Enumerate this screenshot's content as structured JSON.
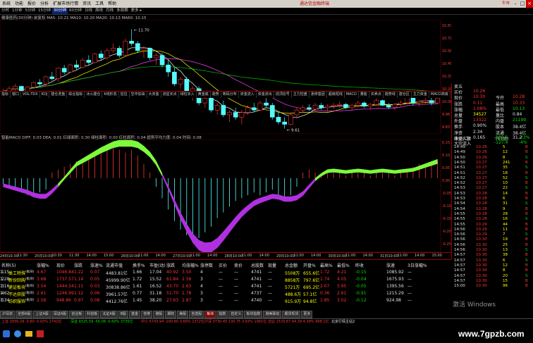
{
  "menu": {
    "items": [
      "系统",
      "功能",
      "报价",
      "分析",
      "扩展市场行情",
      "资讯",
      "工具",
      "帮助"
    ],
    "title": "通达信金融终端",
    "badge": "牛市"
  },
  "periods": [
    "分时",
    "1分钟",
    "5分钟",
    "15分钟",
    "30分钟",
    "60分钟",
    "日线",
    "周线",
    "月线",
    "多周期",
    "更多 ▸"
  ],
  "periods_active": 4,
  "chart": {
    "info": "健康医药(30分钟) 前复权  MA5: 10.21  MA10: 10.20  MA20: 10.13  MA60: 10.15",
    "high_label": "11.70",
    "low_label": "9.61",
    "price_scale": [
      "10.83",
      "10.71",
      "10.58",
      "10.45",
      "10.33",
      "10.20",
      "10.08",
      "9.96",
      "9.83"
    ],
    "macd_info": "智能MACD  DIFF: 0.03  DEA: 0.01  红绿面积: 0.30  绿柱面积: 0.00  红柱面积: 0.04  趋势平均力度: 0.04  时间: 0.08",
    "macd_scale": [
      "0.15",
      "0.10",
      "0.05",
      "0.00",
      "-0.05",
      "-0.10",
      "-0.15",
      "-0.20",
      "-0.25"
    ],
    "indicator_tabs": [
      "指标",
      "窗口",
      "VOL-TDX",
      "KDJ",
      "建仓洗盘",
      "综合指标",
      "冰火建仓",
      "K线形态",
      "狂拉",
      "空中加油",
      "大资金",
      "流星买点",
      "绿柱买入",
      "黄金底",
      "趋势",
      "筹码分布",
      "资金流入",
      "资金流出",
      "逃顶信号",
      "主力控盘",
      "涨停基因",
      "超级短线",
      "MACD",
      "量能",
      "买卖点",
      "趋势线",
      "建仓区",
      "主力资金",
      "MACD高级",
      "智能MACD",
      "更多"
    ],
    "time_labels": [
      "24日10:30",
      "11:30",
      "25日10:00",
      "10:30",
      "11:30",
      "14:00",
      "15:00",
      "26日10:00",
      "11:00",
      "14:00",
      "27日10:00",
      "11:00",
      "14:00",
      "28日10:00",
      "11:00",
      "14:00",
      "29日10:00",
      "11:00",
      "14:00",
      "30日10:00",
      "11:00",
      "14:00",
      "31日10:00",
      "11:00",
      "14:00",
      "15:00"
    ]
  },
  "chart_data": {
    "type": "candlestick",
    "title": "",
    "ylim": [
      9.5,
      11.9
    ],
    "candles": [
      [
        10.3,
        10.45,
        10.25,
        10.4
      ],
      [
        10.4,
        10.5,
        10.35,
        10.45
      ],
      [
        10.45,
        10.55,
        10.4,
        10.5
      ],
      [
        10.5,
        10.5,
        10.35,
        10.38
      ],
      [
        10.38,
        10.5,
        10.3,
        10.48
      ],
      [
        10.48,
        10.6,
        10.45,
        10.58
      ],
      [
        10.58,
        10.65,
        10.5,
        10.55
      ],
      [
        10.55,
        10.72,
        10.5,
        10.7
      ],
      [
        10.7,
        10.8,
        10.62,
        10.66
      ],
      [
        10.66,
        10.9,
        10.6,
        10.88
      ],
      [
        10.88,
        10.95,
        10.75,
        10.8
      ],
      [
        10.8,
        10.98,
        10.78,
        10.95
      ],
      [
        10.95,
        11.05,
        10.85,
        10.9
      ],
      [
        10.9,
        11.1,
        10.88,
        11.05
      ],
      [
        11.05,
        11.15,
        10.95,
        11.0
      ],
      [
        11.0,
        11.2,
        10.98,
        11.18
      ],
      [
        11.18,
        11.25,
        11.05,
        11.1
      ],
      [
        11.1,
        11.3,
        11.05,
        11.25
      ],
      [
        11.25,
        11.4,
        11.2,
        11.3
      ],
      [
        11.3,
        11.35,
        11.1,
        11.15
      ],
      [
        11.15,
        11.5,
        11.12,
        11.45
      ],
      [
        11.45,
        11.7,
        11.35,
        11.4
      ],
      [
        11.4,
        11.45,
        11.2,
        11.25
      ],
      [
        11.25,
        11.35,
        11.1,
        11.3
      ],
      [
        11.3,
        11.32,
        11.05,
        11.1
      ],
      [
        11.1,
        11.2,
        10.95,
        11.15
      ],
      [
        11.15,
        11.2,
        10.9,
        10.95
      ],
      [
        10.95,
        11.05,
        10.7,
        10.8
      ],
      [
        10.8,
        10.9,
        10.5,
        10.55
      ],
      [
        10.55,
        10.7,
        10.45,
        10.65
      ],
      [
        10.65,
        10.7,
        10.3,
        10.35
      ],
      [
        10.35,
        10.5,
        10.2,
        10.45
      ],
      [
        10.45,
        10.5,
        10.1,
        10.15
      ],
      [
        10.15,
        10.3,
        10.05,
        10.25
      ],
      [
        10.25,
        10.3,
        9.95,
        10.0
      ],
      [
        10.0,
        10.15,
        9.9,
        10.1
      ],
      [
        10.1,
        10.2,
        9.85,
        9.9
      ],
      [
        9.9,
        10.0,
        9.75,
        9.95
      ],
      [
        9.95,
        10.05,
        9.8,
        9.85
      ],
      [
        9.85,
        10.0,
        9.7,
        9.95
      ],
      [
        9.95,
        10.1,
        9.9,
        10.05
      ],
      [
        10.05,
        10.15,
        9.95,
        10.0
      ],
      [
        10.0,
        10.2,
        9.98,
        10.15
      ],
      [
        10.15,
        10.25,
        10.05,
        10.1
      ],
      [
        10.1,
        10.15,
        9.8,
        9.85
      ],
      [
        9.85,
        9.95,
        9.7,
        9.75
      ],
      [
        9.75,
        9.85,
        9.61,
        9.7
      ],
      [
        9.7,
        9.95,
        9.68,
        9.9
      ],
      [
        9.9,
        10.05,
        9.85,
        10.0
      ],
      [
        10.0,
        10.1,
        9.95,
        10.05
      ],
      [
        10.05,
        10.12,
        9.98,
        10.02
      ],
      [
        10.02,
        10.15,
        10.0,
        10.1
      ],
      [
        10.1,
        10.15,
        10.0,
        10.05
      ],
      [
        10.05,
        10.12,
        9.98,
        10.08
      ],
      [
        10.08,
        10.15,
        10.02,
        10.1
      ],
      [
        10.1,
        10.18,
        10.05,
        10.12
      ],
      [
        10.12,
        10.15,
        10.02,
        10.05
      ],
      [
        10.05,
        10.12,
        10.0,
        10.1
      ],
      [
        10.1,
        10.2,
        10.05,
        10.15
      ],
      [
        10.15,
        10.18,
        10.05,
        10.08
      ],
      [
        10.08,
        10.15,
        10.0,
        10.12
      ],
      [
        10.12,
        10.25,
        10.1,
        10.2
      ],
      [
        10.2,
        10.22,
        10.08,
        10.1
      ],
      [
        10.1,
        10.15,
        10.02,
        10.06
      ],
      [
        10.06,
        10.14,
        10.0,
        10.12
      ],
      [
        10.12,
        10.2,
        10.08,
        10.15
      ],
      [
        10.15,
        10.35,
        10.12,
        10.3
      ],
      [
        10.3,
        10.32,
        10.1,
        10.15
      ],
      [
        10.15,
        10.22,
        10.08,
        10.18
      ],
      [
        10.18,
        10.25,
        10.12,
        10.2
      ],
      [
        10.2,
        10.28,
        10.1,
        10.15
      ],
      [
        10.15,
        10.3,
        10.12,
        10.25
      ]
    ],
    "macd_hist": [
      -0.02,
      -0.03,
      -0.04,
      -0.05,
      -0.06,
      -0.06,
      -0.05,
      -0.04,
      0.02,
      0.03,
      0.04,
      0.05,
      0.06,
      0.07,
      0.08,
      0.09,
      0.1,
      0.1,
      0.11,
      0.1,
      0.09,
      0.1,
      0.08,
      0.05,
      0.02,
      -0.03,
      -0.07,
      -0.11,
      -0.15,
      -0.18,
      -0.2,
      -0.22,
      -0.21,
      -0.19,
      -0.17,
      -0.14,
      -0.12,
      -0.1,
      -0.08,
      -0.07,
      -0.06,
      -0.05,
      -0.06,
      -0.05,
      -0.04,
      -0.07,
      -0.08,
      -0.06,
      -0.03,
      0.02,
      0.03,
      0.02,
      0.01,
      0.02,
      0.03,
      0.02,
      0.01,
      0.02,
      0.03,
      0.02,
      0.01,
      0.02,
      0.03,
      0.02,
      0.01,
      0.02,
      0.03,
      0.04,
      0.05,
      0.04,
      0.05,
      0.06
    ]
  },
  "quote": {
    "rows": [
      {
        "l": "卖五",
        "v": "",
        "c": ""
      },
      {
        "l": "买价",
        "v": "10.26",
        "c": "red"
      },
      {
        "l": "现价",
        "v": "10.30",
        "c": "red",
        "l2": "今开",
        "v2": "10.28",
        "c2": "red"
      },
      {
        "l": "涨跌",
        "v": "0.11",
        "c": "red",
        "l2": "最高",
        "v2": "10.33",
        "c2": "red"
      },
      {
        "l": "涨幅",
        "v": "1.08%",
        "c": "red",
        "l2": "最低",
        "v2": "10.13",
        "c2": "grn"
      },
      {
        "l": "总量",
        "v": "34527",
        "c": "yel",
        "l2": "量比",
        "v2": "0.84",
        "c2": "wht"
      },
      {
        "l": "外盘",
        "v": "13322",
        "c": "red",
        "l2": "内盘",
        "v2": "21199",
        "c2": "grn"
      },
      {
        "l": "换手",
        "v": "0.90%",
        "c": "wht",
        "l2": "股本",
        "v2": "38.4亿",
        "c2": "wht"
      },
      {
        "l": "净资",
        "v": "2.34",
        "c": "wht",
        "l2": "流通",
        "v2": "38.4亿",
        "c2": "wht"
      },
      {
        "l": "收益(二)",
        "v": "0.165",
        "c": "wht",
        "l2": "PE(动)",
        "v2": "31.2",
        "c2": "wht"
      }
    ],
    "flow": [
      {
        "l": "净流入额",
        "v": "-809.5",
        "v2": "-23%"
      },
      {
        "l": "大宗流入",
        "v": "-127.4",
        "v2": "-4%"
      }
    ]
  },
  "ticks": [
    [
      "14:49",
      "10.26",
      "5",
      "B"
    ],
    [
      "14:49",
      "10.26",
      "12",
      "B"
    ],
    [
      "14:50",
      "10.26",
      "8",
      "S"
    ],
    [
      "14:50",
      "10.27",
      "241",
      "B"
    ],
    [
      "14:51",
      "10.27",
      "35",
      "S"
    ],
    [
      "14:51",
      "10.27",
      "18",
      "B"
    ],
    [
      "14:52",
      "10.27",
      "52",
      "S"
    ],
    [
      "14:52",
      "10.27",
      "10",
      "B"
    ],
    [
      "14:53",
      "10.27",
      "22",
      "S"
    ],
    [
      "14:53",
      "10.28",
      "14",
      "B"
    ],
    [
      "14:53",
      "10.28",
      "6",
      "B"
    ],
    [
      "14:54",
      "10.28",
      "31",
      "S"
    ],
    [
      "14:54",
      "10.28",
      "9",
      "B"
    ],
    [
      "14:55",
      "10.28",
      "28",
      "B"
    ],
    [
      "14:55",
      "10.28",
      "16",
      "S"
    ],
    [
      "14:55",
      "10.29",
      "44",
      "B"
    ],
    [
      "14:56",
      "10.29",
      "11",
      "B"
    ],
    [
      "14:56",
      "10.29",
      "7",
      "S"
    ],
    [
      "14:56",
      "10.30",
      "19",
      "B"
    ],
    [
      "14:56",
      "10.30",
      "25",
      "B"
    ],
    [
      "14:56",
      "10.30",
      "13",
      "S"
    ],
    [
      "14:57",
      "10.30",
      "38",
      "B"
    ],
    [
      "14:57",
      "10.30",
      "6",
      "S"
    ],
    [
      "14:57",
      "10.30",
      "12",
      "B"
    ],
    [
      "14:57",
      "10.30",
      "8",
      "B"
    ],
    [
      "14:57",
      "10.30",
      "20",
      "S"
    ],
    [
      "14:57",
      "10.30",
      "15",
      "B"
    ],
    [
      "15:00",
      "10.30",
      "96",
      "B"
    ]
  ],
  "table": {
    "headers": [
      "名称(5)",
      "涨幅%",
      "现价",
      "涨跌",
      "涨速%",
      "流通市值",
      "换手%",
      "市盈(动)",
      "涨跌",
      "均涨幅%",
      "涨停数",
      "买价",
      "卖价",
      "总股数",
      "现量",
      "总金额",
      "开盘%",
      "最高%",
      "最低%",
      "昨收",
      "涨速",
      "3日涨幅%"
    ],
    "rows": [
      {
        "n": "1",
        "name": "类工特殊",
        "tag": "(板块)",
        "c": [
          "4.67",
          "1046.84",
          "1.22",
          "0.07",
          "4483.81亿",
          "1.66",
          "17.04",
          "40.92",
          "3.50",
          "4",
          "—",
          "—",
          "4741",
          "—",
          "5508万",
          "655.6亿",
          "1.72",
          "4.21",
          "-0.15",
          "1085.92",
          "—",
          "1.15"
        ]
      },
      {
        "n": "2",
        "name": "新份回购",
        "tag": "(板块)",
        "c": [
          "3.68",
          "1737.57",
          "1.14",
          "0.05",
          "45999.90亿",
          "1.72",
          "15.52",
          "61.84",
          "2.56",
          "3",
          "—",
          "—",
          "4741",
          "—",
          "8858万",
          "797.6亿",
          "1.74",
          "4.05",
          "-0.04",
          "1675.93",
          "—",
          "1.28"
        ]
      },
      {
        "n": "3",
        "name": "递证板块",
        "tag": "(板块)",
        "c": [
          "3.54",
          "1444.54",
          "1.11",
          "0.03",
          "30838.86亿",
          "1.61",
          "16.52",
          "43.70",
          "2.63",
          "4",
          "—",
          "—",
          "4741",
          "—",
          "5721万",
          "695.2亿",
          "2.07",
          "3.95",
          "-0.05",
          "1395.56",
          "—",
          "1.16"
        ]
      },
      {
        "n": "4",
        "name": "不达获股",
        "tag": "(板块)",
        "c": [
          "2.61",
          "1246.99",
          "1.12",
          "0.06",
          "3961.57亿",
          "0.77",
          "31.18",
          "51.70",
          "2.78",
          "3",
          "—",
          "—",
          "4737",
          "—",
          "488.6万",
          "57.1亿",
          "0.36",
          "2.61",
          "-0.91",
          "1215.29",
          "—",
          "1.62"
        ]
      },
      {
        "n": "5",
        "name": "纺织服饰",
        "tag": "(板块)",
        "c": [
          "2.58",
          "948.86",
          "0.97",
          "0.08",
          "4412.76亿",
          "1.45",
          "38.20",
          "27.63",
          "2.87",
          "3",
          "—",
          "—",
          "4740",
          "—",
          "915.9万",
          "94.8亿",
          "1.85",
          "3.02",
          "-0.12",
          "924.98",
          "—",
          "1.34"
        ]
      }
    ]
  },
  "bottom_tabs": [
    "沪深京",
    "全部A股",
    "上证A股",
    "深证A股",
    "创业板",
    "科创板",
    "北证A股",
    "B股",
    "基金",
    "债券",
    "港股",
    "期权",
    "美股",
    "自选股",
    "板块",
    "指数",
    "自定义",
    "板块指数",
    "港美联动",
    "期货现货",
    "更多"
  ],
  "bottom_tabs_active": 14,
  "status": {
    "sh": "上证 2939.29  -0.80  -0.03%  2742亿",
    "sz": "深证 9325.59 -56.08 -0.60% 3735亿",
    "cy": "中小 5743.94 -200.80 3.66% 1372亿",
    "extra": "沪深 3730.45  130.75 3.63% 1991亿",
    "bj": "创业 1533.87  64.39  4.38%  998.1亿",
    "conn": "北京行情主站2"
  },
  "watermark": "激活 Windows",
  "site": "www.7gpzb.com"
}
